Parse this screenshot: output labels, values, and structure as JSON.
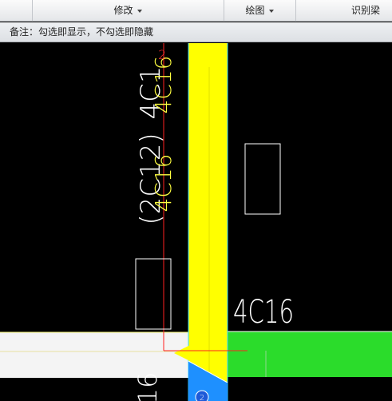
{
  "ribbon": {
    "groups": [
      {
        "label": "修改",
        "has_dropdown": true
      },
      {
        "label": "绘图",
        "has_dropdown": true
      },
      {
        "label": "识别梁",
        "has_dropdown": false
      }
    ]
  },
  "notebar": {
    "text": "备注：勾选即显示，不勾选即隐藏"
  },
  "canvas": {
    "texts": {
      "top_white": "4C1",
      "top_yellow": "4C16",
      "mid_white": "(2C12)",
      "mid_yellow": "4C16",
      "right_white": "4C16",
      "bottom_white": "16",
      "corner_red": "2",
      "circle_badge": "2"
    },
    "colors": {
      "background": "#000000",
      "column_fill": "#ffff00",
      "slab_fill": "#2bdc2b",
      "beam_band": "#ffffff",
      "axis_red": "#ff2020",
      "edge_cyan": "#33d6ff",
      "badge_blue": "#1e90ff"
    }
  }
}
